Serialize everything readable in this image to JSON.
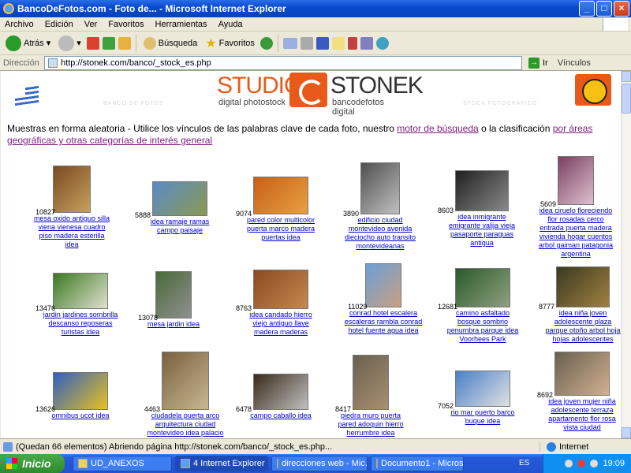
{
  "window": {
    "title": "BancoDeFotos.com - Foto de... - Microsoft Internet Explorer"
  },
  "menu": [
    "Archivo",
    "Edición",
    "Ver",
    "Favoritos",
    "Herramientas",
    "Ayuda"
  ],
  "toolbar": {
    "back": "Atrás",
    "search": "Búsqueda",
    "favorites": "Favoritos"
  },
  "address": {
    "label": "Dirección",
    "url": "http://stonek.com/banco/_stock_es.php",
    "go": "Ir",
    "links": "Vínculos"
  },
  "page": {
    "logo_left": "STUDIO",
    "logo_right": "STONEK",
    "logo_sub_left": "digital photostock",
    "logo_sub_right": "bancodefotos digital",
    "wm1": "BANCO DE FOTOS",
    "wm2": "STOCK FOTOGRÁFICO",
    "intro_text1": "Muestras en forma aleatoria - Utilice los vínculos de las palabras clave de cada foto, nuestro",
    "intro_link1": "motor de búsqueda",
    "intro_text2": "o la clasificación",
    "intro_link2": "por áreas geográficas y otras categorías de interés general"
  },
  "photos": [
    {
      "num": "10827",
      "kw": "mesa oxido antiguo silla viena vienesa cuadro piso madera esterilla idea",
      "c1": "#7a4a20",
      "c2": "#c8a060"
    },
    {
      "num": "5888",
      "kw": "idea ramaje ramas campo paisaje",
      "c1": "#5a8ac8",
      "c2": "#8a9a50"
    },
    {
      "num": "9074",
      "kw": "pared color multicolor puerta marco madera puertas idea",
      "c1": "#c86018",
      "c2": "#e8a040"
    },
    {
      "num": "3890",
      "kw": "edificio ciudad montevideo avenida dieciocho auto transito montevideanas",
      "c1": "#505050",
      "c2": "#c0c0c0"
    },
    {
      "num": "8603",
      "kw": "idea inmigrante emigrante valija vieja pasaporte paraguas antigua",
      "c1": "#202020",
      "c2": "#8a8a8a"
    },
    {
      "num": "5609",
      "kw": "idea ciruelo floreciendo flor rosadas cerco entrada puerta madera vivienda hogar cuentos arbol gaiman patagonia argentina",
      "c1": "#7a4060",
      "c2": "#e0c0d0"
    },
    {
      "num": "13476",
      "kw": "jardin jardines sombrilla descanso reposeras turistas idea",
      "c1": "#3a7a20",
      "c2": "#e0e0d0"
    },
    {
      "num": "13078",
      "kw": "mesa jardin idea",
      "c1": "#4a6a3a",
      "c2": "#909090"
    },
    {
      "num": "8763",
      "kw": "idea candado hierro viejo antiguo llave madera maderas",
      "c1": "#8a4a20",
      "c2": "#c88850"
    },
    {
      "num": "11029",
      "kw": "conrad hotel escalera escaleras rambla conrad hotel fuente agua idea",
      "c1": "#6aa0d8",
      "c2": "#c8a080"
    },
    {
      "num": "12681",
      "kw": "camino asfaltado bosque sombrio penumbra parque idea Voorhees Park",
      "c1": "#2a5a2a",
      "c2": "#90a080"
    },
    {
      "num": "8777",
      "kw": "idea niña joven adolescente plaza parque otoño arbol hoja hojas adolescentes",
      "c1": "#3a3a20",
      "c2": "#a08040"
    },
    {
      "num": "13626",
      "kw": "omnibus ucot idea",
      "c1": "#3060c0",
      "c2": "#e8c020"
    },
    {
      "num": "4463",
      "kw": "ciudadela puerta arco arquitectura ciudad montevideo idea palacio salvo plaza",
      "c1": "#7a6040",
      "c2": "#c8b890"
    },
    {
      "num": "6478",
      "kw": "campo caballo idea",
      "c1": "#3a2a1a",
      "c2": "#c0c0c0"
    },
    {
      "num": "8417",
      "kw": "piedra muro puerta pared adoquin hierro herrumbre idea",
      "c1": "#6a6050",
      "c2": "#a89070"
    },
    {
      "num": "7052",
      "kw": "rio mar puerto barco buque idea",
      "c1": "#4a80c8",
      "c2": "#e0e0e0"
    },
    {
      "num": "8692",
      "kw": "idea joven mujer niña adolescente terraza apartamento flor rosa vista ciudad",
      "c1": "#6a6050",
      "c2": "#d0b090"
    }
  ],
  "status": {
    "text": "(Quedan 66 elementos) Abriendo página http://stonek.com/banco/_stock_es.php...",
    "zone": "Internet"
  },
  "taskbar": {
    "start": "Inicio",
    "tasks": [
      "UD_ANEXOS",
      "4 Internet Explorer",
      "direcciones web - Mic...",
      "Documento1 - Micros..."
    ],
    "lang": "ES",
    "clock": "19:09"
  }
}
